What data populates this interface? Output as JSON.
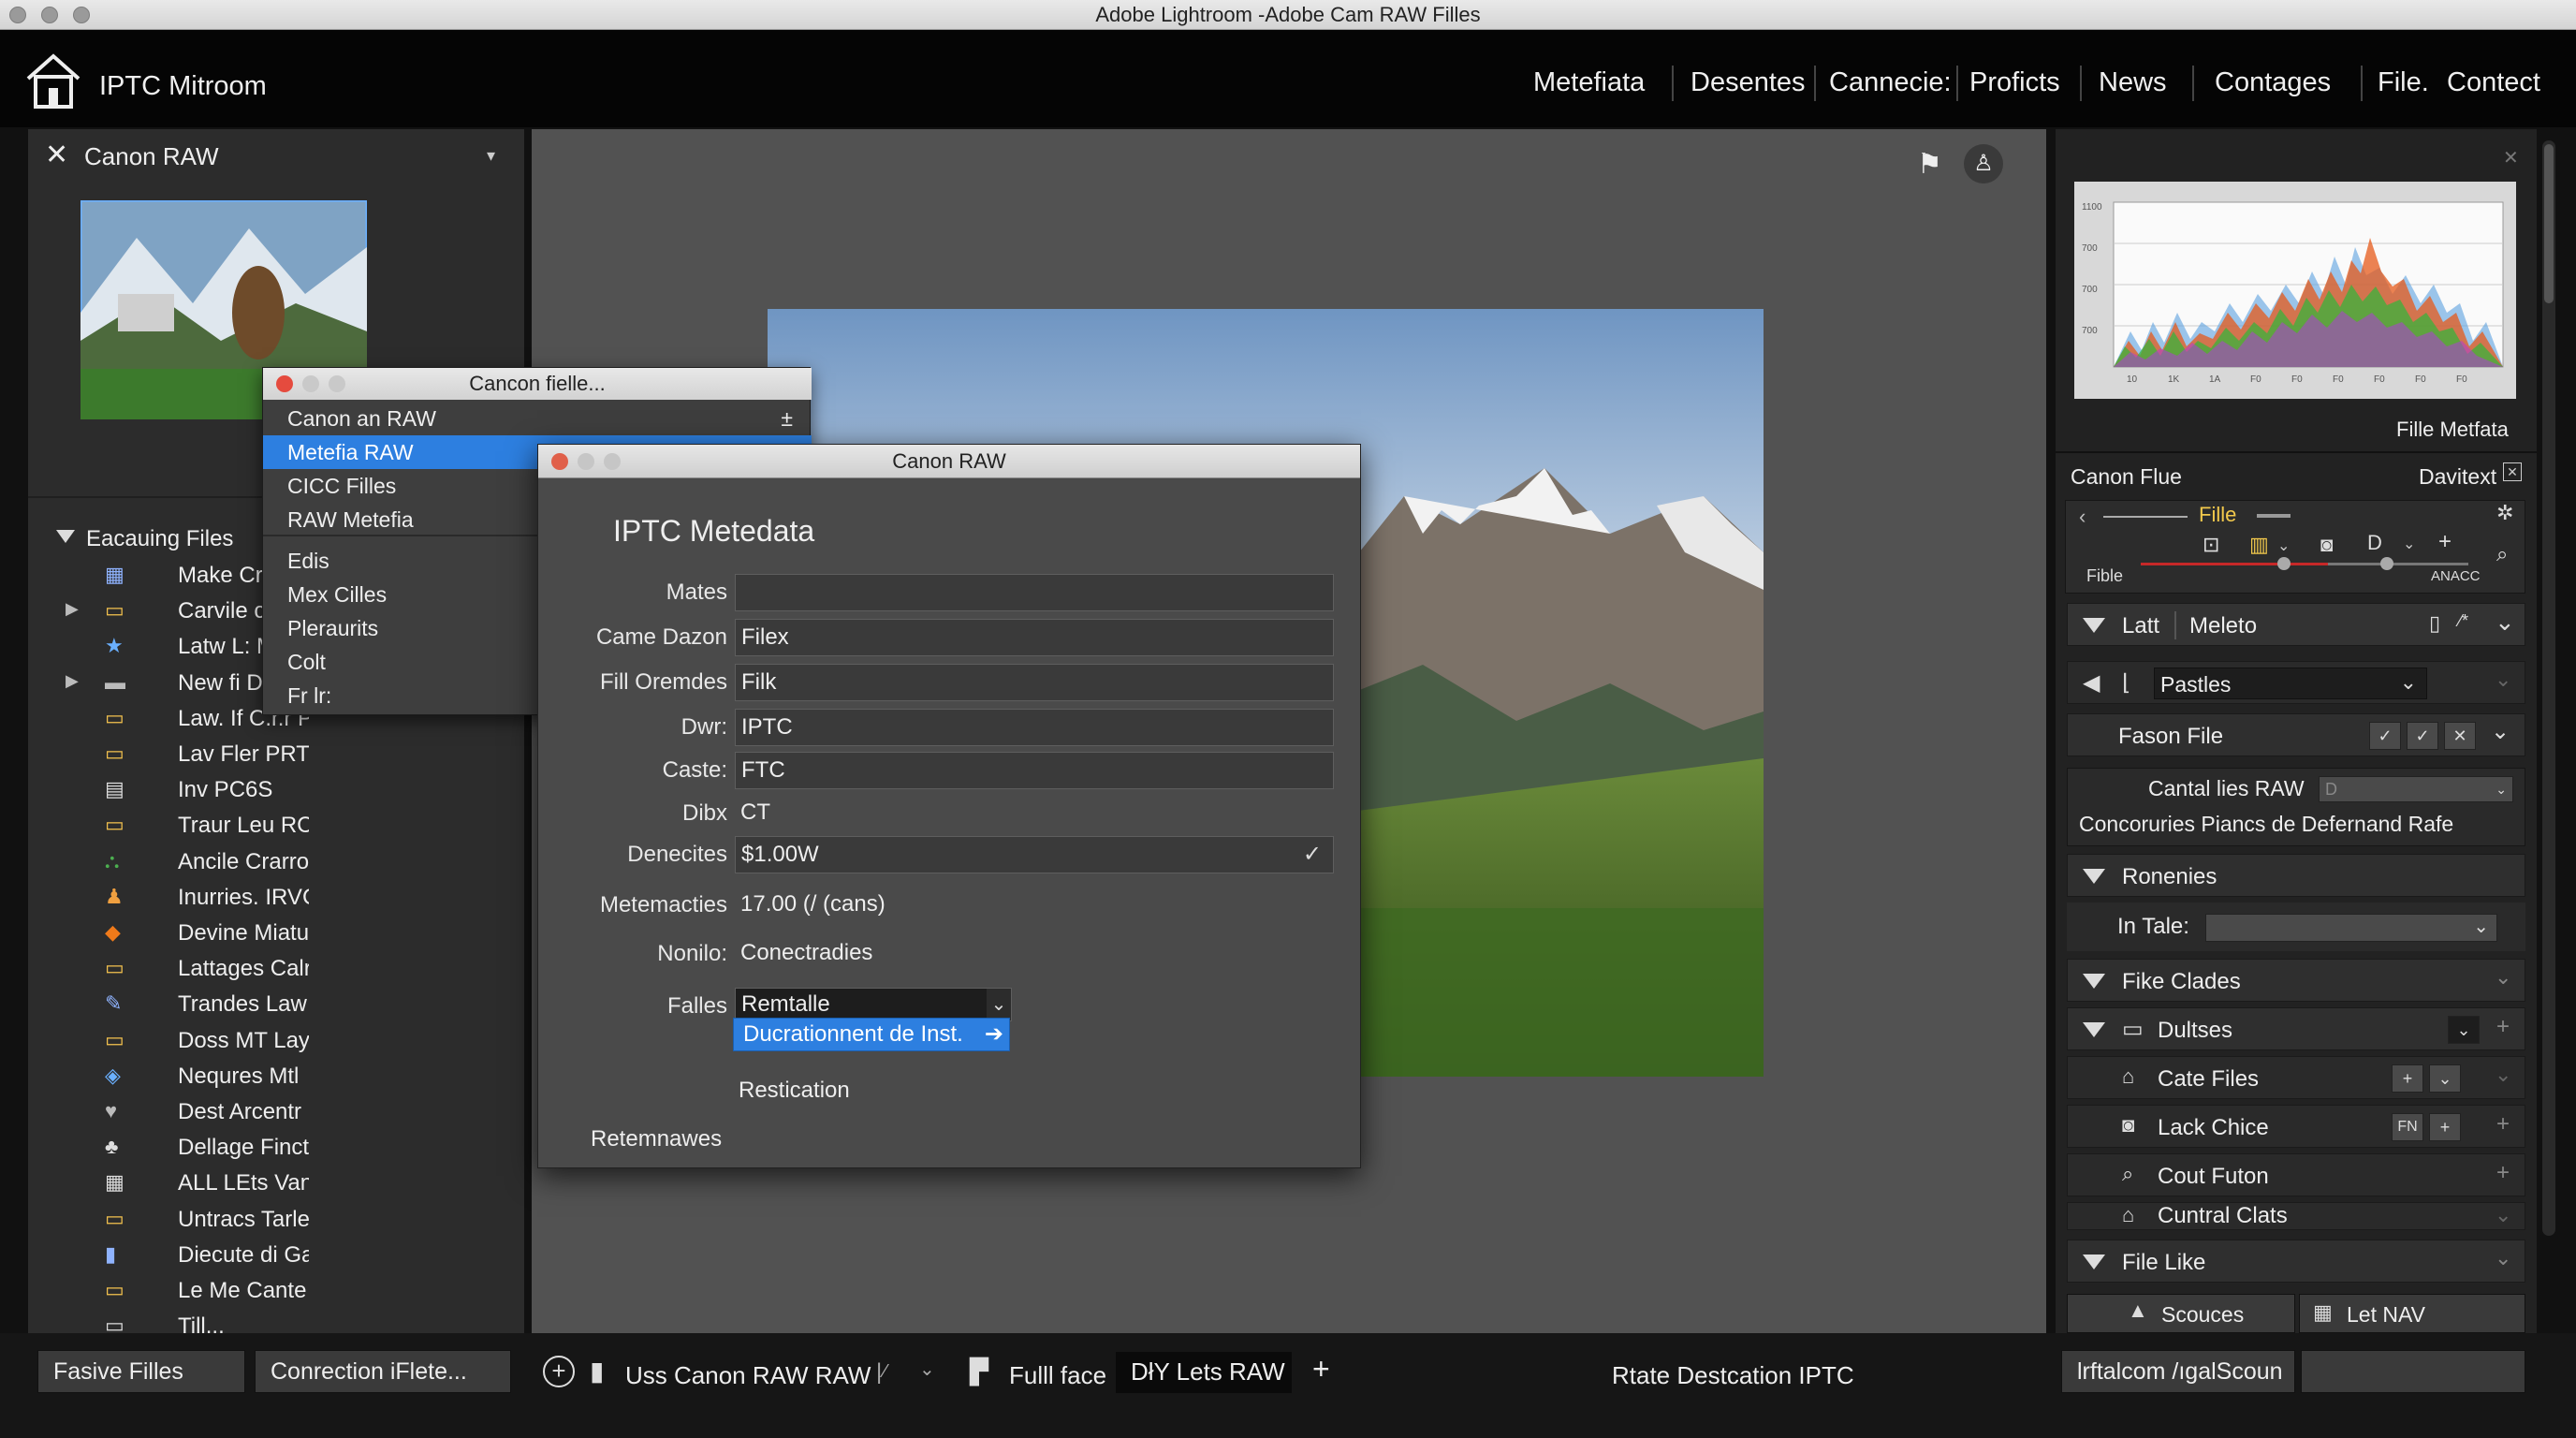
{
  "window": {
    "title": "Adobe Lightroom -Adobe Cam RAW Filles"
  },
  "app": {
    "name": "IPTC Mitroom"
  },
  "nav": [
    "Metefiata",
    "Desentes",
    "Cannecie:",
    "Proficts",
    "News",
    "Contages",
    "File.",
    "Contect"
  ],
  "left_panel": {
    "header": "Canon RAW",
    "tree_header": "Eacauing Files",
    "items": [
      "Make Craner",
      "Carvile c",
      "Latw L: M",
      "New fi D",
      "Law. If C.r.r P",
      "Lav Fler PRTV",
      "Inv PC6S",
      "Traur Leu RCL",
      "Ancile Crarro",
      "Inurries. IRVC",
      "Devine Miatu",
      "Lattages Calr",
      "Trandes Law",
      "Doss MT Lay",
      "Nequres Mtl",
      "Dest Arcentr",
      "Dellage Finctes Like",
      "ALL LEts Vanible",
      "Untracs Tarles",
      "Diecute di Gaugle",
      "Le Me Cante",
      "Till..."
    ]
  },
  "context_menu": {
    "title": "Cancon fielle...",
    "items": [
      "Canon an RAW",
      "Metefia RAW",
      "CICC Filles",
      "RAW Metefia",
      "Edis",
      "Mex Cilles",
      "Pleraurits",
      "Colt",
      "Fr lr:"
    ],
    "selected_index": 1,
    "item0_shortcut": "±"
  },
  "dialog": {
    "title": "Canon RAW",
    "heading": "IPTC Metedata",
    "fields": [
      {
        "label": "Mates",
        "value": ""
      },
      {
        "label": "Came Dazon",
        "value": "Filex"
      },
      {
        "label": "Fill Oremdes",
        "value": "Filk"
      },
      {
        "label": "Dwr:",
        "value": "IPTC"
      },
      {
        "label": "Caste:",
        "value": "FTC"
      },
      {
        "label": "Dibx",
        "value": "CT"
      },
      {
        "label": "Denecites",
        "value": "$1.00W"
      },
      {
        "label": "Metemacties",
        "value": "17.00 (/ (cans)"
      },
      {
        "label": "Nonilo:",
        "value": "Conectradies"
      },
      {
        "label": "Falles",
        "value": "Remtalle"
      }
    ],
    "action_button": "Ducrationnent de Inst.",
    "restication": "Restication",
    "footer": "Retemnawes"
  },
  "right_panel": {
    "histogram_ticks_y": [
      "1100",
      "700",
      "700",
      "700"
    ],
    "histogram_ticks_x": [
      "10",
      "1K",
      "1A",
      "F0",
      "F0",
      "F0",
      "F0",
      "F0",
      "F0"
    ],
    "histogram_label": "Fille Metfata",
    "section1": {
      "left": "Canon Flue",
      "right": "Davitext"
    },
    "tool_label": "Fille",
    "tool_left": "Fible",
    "tool_right": "ANACC",
    "row_latt": "Latt",
    "row_meleto": "Meleto",
    "row_pastles": "Pastles",
    "row_fason": "Fason File",
    "cantal_label": "Cantal lies RAW",
    "cantal_value": "D",
    "concoruries": "Concoruries Piancs de Defernand Rafe",
    "row_ronenies": "Ronenies",
    "in_tale": "In Tale:",
    "row_fike_clades": "Fike Clades",
    "row_dultses": "Dultses",
    "row_cate_files": "Cate Files",
    "row_lack_chice": "Lack Chice",
    "lack_badge": "FN",
    "row_cout_futon": "Cout Futon",
    "row_cuntral": "Cuntral Clats",
    "row_file_like": "File Like",
    "btn_scouces": "Scouces",
    "btn_letnav": "Let NAV"
  },
  "bottom_bar": {
    "left_btn1": "Fasive Filles",
    "left_btn2": "Conrection iFlete...",
    "center_label": "Uss Canon RAW RAW",
    "fullface": "Fulll face",
    "dky": "DłY Lets RAW",
    "rtate": "Rtate Destcation IPTC",
    "right_field": "lrftalcom /ıgalScoun"
  }
}
